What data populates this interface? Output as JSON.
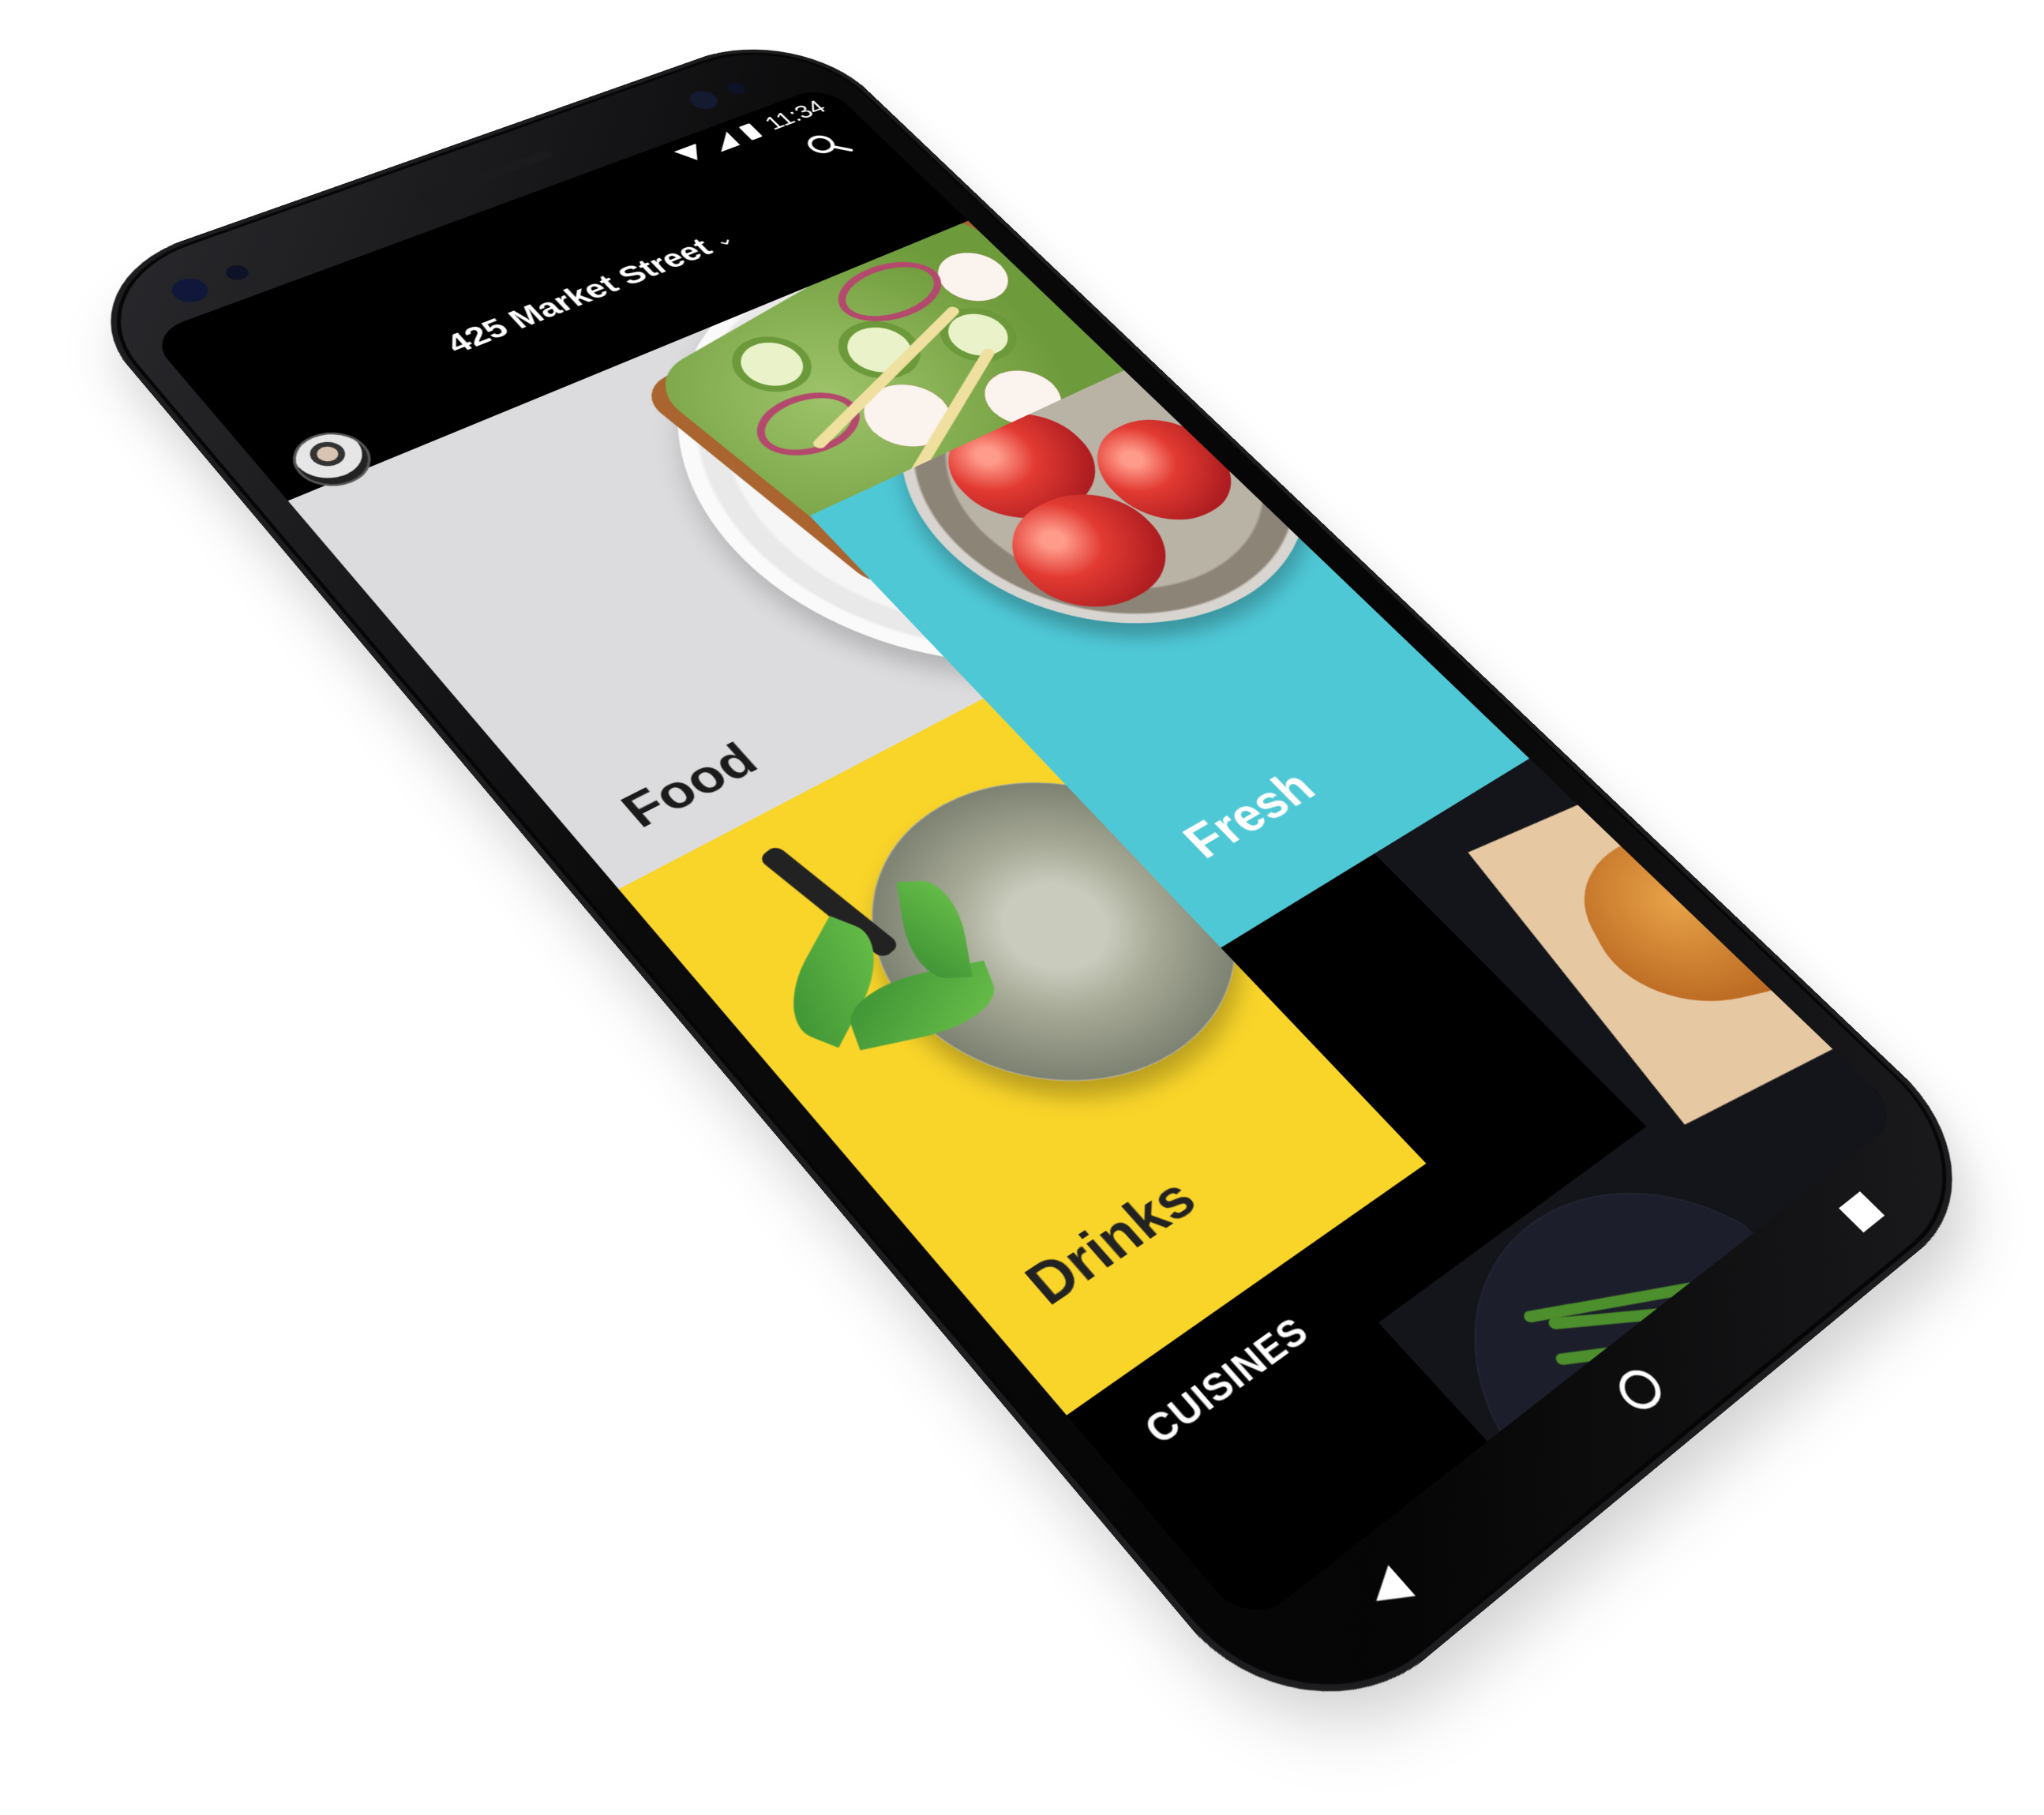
{
  "status_bar": {
    "time": "11:34"
  },
  "header": {
    "address": "425 Market Street",
    "address_chevron": "chevron-down-icon",
    "search_icon": "search-icon",
    "avatar": "user-avatar"
  },
  "categories": [
    {
      "label": "Food",
      "color": "#dcdcde"
    },
    {
      "label": "Drinks",
      "color": "#f9d52a"
    },
    {
      "label": "Fresh",
      "color": "#4fc8d6"
    }
  ],
  "section": {
    "title": "CUISINES"
  },
  "nav": {
    "back": "back-icon",
    "home": "home-icon",
    "recents": "recents-icon"
  }
}
